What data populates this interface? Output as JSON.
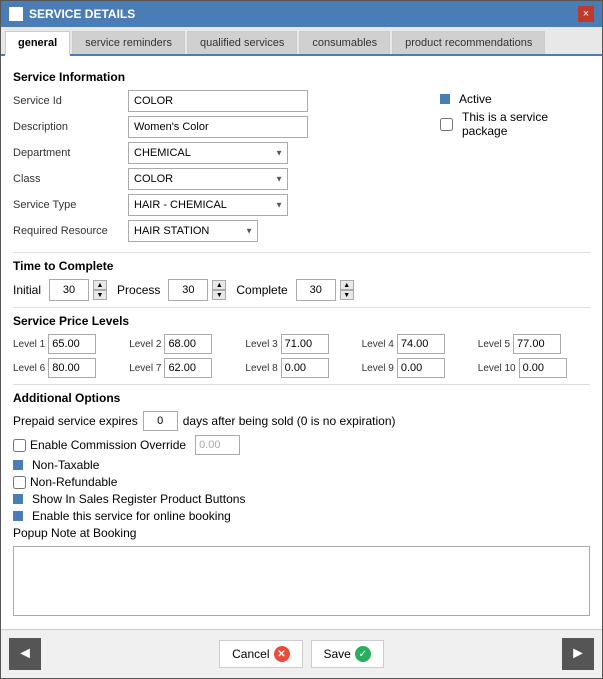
{
  "window": {
    "title": "SERVICE DETAILS",
    "close_label": "×"
  },
  "tabs": [
    {
      "id": "general",
      "label": "general",
      "active": true
    },
    {
      "id": "service-reminders",
      "label": "service reminders",
      "active": false
    },
    {
      "id": "qualified-services",
      "label": "qualified services",
      "active": false
    },
    {
      "id": "consumables",
      "label": "consumables",
      "active": false
    },
    {
      "id": "product-recommendations",
      "label": "product recommendations",
      "active": false
    }
  ],
  "service_information": {
    "section_title": "Service Information",
    "service_id_label": "Service Id",
    "service_id_value": "COLOR",
    "description_label": "Description",
    "description_value": "Women's Color",
    "department_label": "Department",
    "department_value": "CHEMICAL",
    "department_options": [
      "CHEMICAL"
    ],
    "class_label": "Class",
    "class_value": "COLOR",
    "class_options": [
      "COLOR"
    ],
    "service_type_label": "Service Type",
    "service_type_value": "HAIR - CHEMICAL",
    "service_type_options": [
      "HAIR - CHEMICAL"
    ],
    "required_resource_label": "Required Resource",
    "required_resource_value": "HAIR STATION",
    "required_resource_options": [
      "HAIR STATION"
    ],
    "active_label": "Active",
    "active_checked": true,
    "package_label": "This is a service package",
    "package_checked": false
  },
  "time_to_complete": {
    "section_title": "Time to Complete",
    "initial_label": "Initial",
    "initial_value": "30",
    "process_label": "Process",
    "process_value": "30",
    "complete_label": "Complete",
    "complete_value": "30"
  },
  "service_price_levels": {
    "section_title": "Service Price Levels",
    "levels": [
      {
        "label": "Level 1",
        "value": "65.00"
      },
      {
        "label": "Level 2",
        "value": "68.00"
      },
      {
        "label": "Level 3",
        "value": "71.00"
      },
      {
        "label": "Level 4",
        "value": "74.00"
      },
      {
        "label": "Level 5",
        "value": "77.00"
      },
      {
        "label": "Level 6",
        "value": "80.00"
      },
      {
        "label": "Level 7",
        "value": "62.00"
      },
      {
        "label": "Level 8",
        "value": "0.00"
      },
      {
        "label": "Level 9",
        "value": "0.00"
      },
      {
        "label": "Level 10",
        "value": "0.00"
      }
    ]
  },
  "additional_options": {
    "section_title": "Additional Options",
    "prepaid_label": "Prepaid service expires",
    "prepaid_value": "0",
    "prepaid_suffix": "days after being sold (0 is no expiration)",
    "commission_override_label": "Enable Commission Override",
    "commission_value": "0.00",
    "non_taxable_label": "Non-Taxable",
    "non_refundable_label": "Non-Refundable",
    "show_in_sales_label": "Show In Sales Register Product Buttons",
    "online_booking_label": "Enable this service for online booking",
    "popup_note_label": "Popup Note at Booking"
  },
  "footer": {
    "cancel_label": "Cancel",
    "save_label": "Save",
    "prev_icon": "◄",
    "next_icon": "►"
  }
}
